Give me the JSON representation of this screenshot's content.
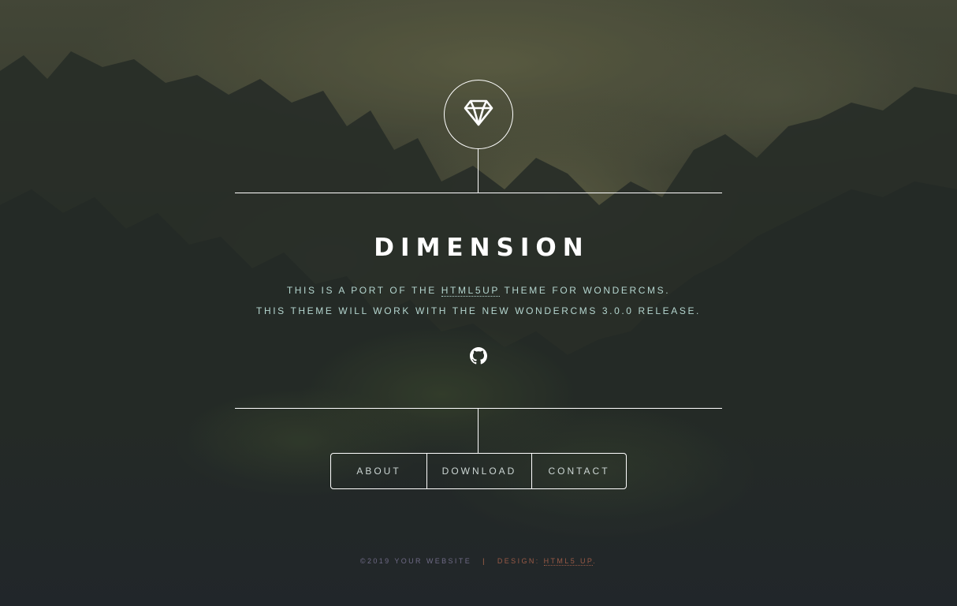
{
  "header": {
    "logo_icon": "diamond-icon",
    "title": "DIMENSION",
    "intro_line1_before": "THIS IS A PORT OF THE ",
    "intro_line1_link": "HTML5UP",
    "intro_line1_after": " THEME FOR WONDERCMS.",
    "intro_line2": "THIS THEME WILL WORK WITH THE NEW WONDERCMS 3.0.0 RELEASE.",
    "social_icon": "github-icon"
  },
  "nav": {
    "items": [
      {
        "label": "ABOUT"
      },
      {
        "label": "DOWNLOAD"
      },
      {
        "label": "CONTACT"
      }
    ]
  },
  "footer": {
    "copyright": "©2019 YOUR WEBSITE",
    "separator": "|",
    "design_label": "DESIGN: ",
    "design_link": "HTML5 UP",
    "design_end": "."
  },
  "colors": {
    "text_primary": "#ffffff",
    "intro_text": "#b4d5cf",
    "footer_text": "#6f6a86",
    "footer_link": "#9a5a46"
  }
}
